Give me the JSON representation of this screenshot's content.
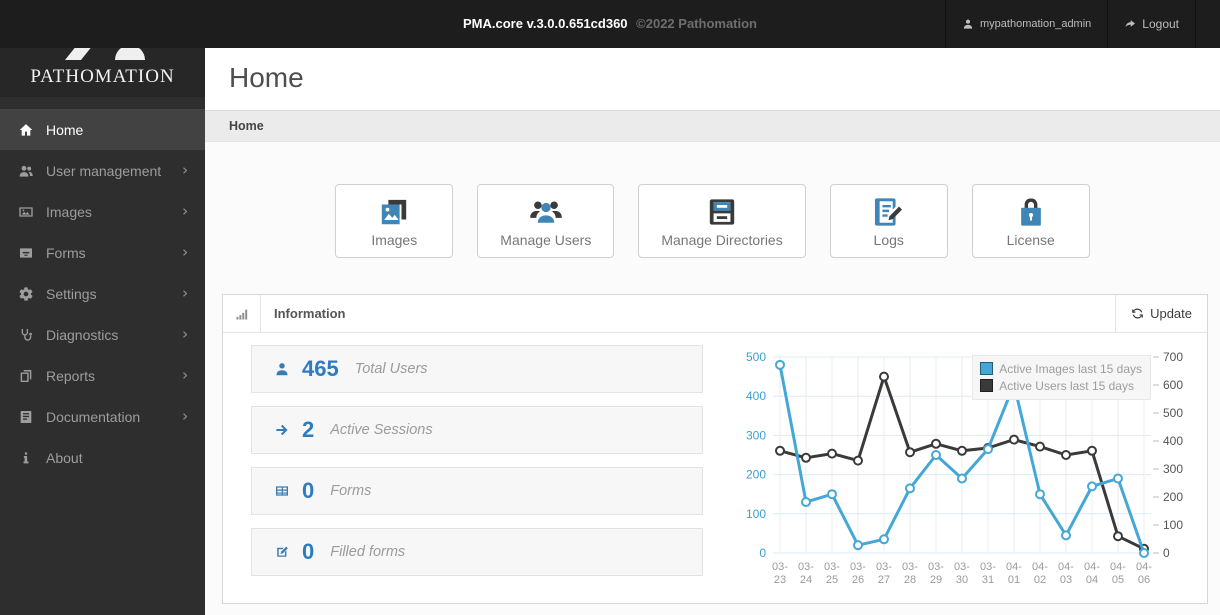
{
  "topbar": {
    "version": "PMA.core v.3.0.0.651cd360",
    "copyright": "©2022 Pathomation",
    "username": "mypathomation_admin",
    "username_icon": "user-icon",
    "logout_label": "Logout",
    "logout_icon": "logout-arrow-icon"
  },
  "sidebar": {
    "brand": "Pathomation",
    "items": [
      {
        "label": "Home",
        "icon": "home-icon",
        "active": true,
        "has_submenu": false
      },
      {
        "label": "User management",
        "icon": "users-icon",
        "active": false,
        "has_submenu": true
      },
      {
        "label": "Images",
        "icon": "image-icon",
        "active": false,
        "has_submenu": true
      },
      {
        "label": "Forms",
        "icon": "forms-icon",
        "active": false,
        "has_submenu": true
      },
      {
        "label": "Settings",
        "icon": "settings-icon",
        "active": false,
        "has_submenu": true
      },
      {
        "label": "Diagnostics",
        "icon": "diagnostics-icon",
        "active": false,
        "has_submenu": true
      },
      {
        "label": "Reports",
        "icon": "reports-icon",
        "active": false,
        "has_submenu": true
      },
      {
        "label": "Documentation",
        "icon": "documentation-icon",
        "active": false,
        "has_submenu": true
      },
      {
        "label": "About",
        "icon": "about-icon",
        "active": false,
        "has_submenu": false
      }
    ]
  },
  "page": {
    "title": "Home",
    "breadcrumb": "Home"
  },
  "cards": [
    {
      "label": "Images",
      "icon": "card-images-icon"
    },
    {
      "label": "Manage Users",
      "icon": "card-users-icon"
    },
    {
      "label": "Manage Directories",
      "icon": "card-dirs-icon"
    },
    {
      "label": "Logs",
      "icon": "card-logs-icon"
    },
    {
      "label": "License",
      "icon": "card-license-icon"
    }
  ],
  "panel": {
    "title": "Information",
    "title_icon": "signal-bars-icon",
    "update_label": "Update",
    "update_icon": "refresh-icon",
    "stats": [
      {
        "value": "465",
        "label": "Total Users",
        "icon": "user-icon"
      },
      {
        "value": "2",
        "label": "Active Sessions",
        "icon": "arrow-right-icon"
      },
      {
        "value": "0",
        "label": "Forms",
        "icon": "table-icon"
      },
      {
        "value": "0",
        "label": "Filled forms",
        "icon": "edit-icon"
      }
    ]
  },
  "chart_data": {
    "type": "line",
    "title": "",
    "categories": [
      "03-23",
      "03-24",
      "03-25",
      "03-26",
      "03-27",
      "03-28",
      "03-29",
      "03-30",
      "03-31",
      "04-01",
      "04-02",
      "04-03",
      "04-04",
      "04-05",
      "04-06"
    ],
    "series": [
      {
        "name": "Active Images last 15 days",
        "axis": "left",
        "color": "#45a7d6",
        "values": [
          480,
          130,
          150,
          20,
          35,
          165,
          250,
          190,
          265,
          430,
          150,
          45,
          170,
          190,
          0
        ]
      },
      {
        "name": "Active Users last 15 days",
        "axis": "right",
        "color": "#3a3a3a",
        "values": [
          365,
          340,
          355,
          330,
          630,
          360,
          390,
          365,
          375,
          405,
          380,
          350,
          365,
          60,
          15
        ]
      }
    ],
    "left_axis": {
      "min": 0,
      "max": 500,
      "ticks": [
        0,
        100,
        200,
        300,
        400,
        500
      ],
      "color": "#3d9fd0"
    },
    "right_axis": {
      "min": 0,
      "max": 700,
      "ticks": [
        0,
        100,
        200,
        300,
        400,
        500,
        600,
        700
      ],
      "color": "#555555"
    },
    "grid": true,
    "legend_position": "top-right"
  },
  "colors": {
    "accent_blue": "#3f85b5",
    "chart_blue": "#45a7d6",
    "chart_dark": "#3a3a3a",
    "topbar_bg": "#1d1d1d",
    "sidebar_bg": "#2e2e2e"
  }
}
